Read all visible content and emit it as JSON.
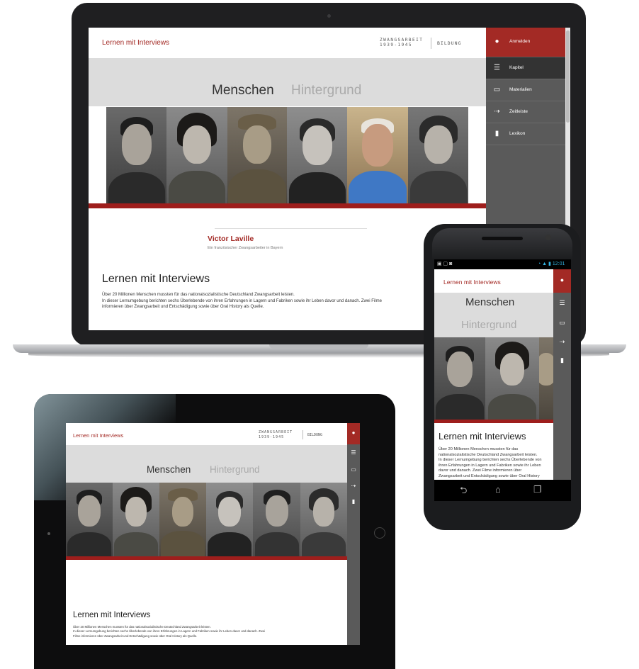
{
  "site": {
    "brand": "Lernen mit Interviews",
    "logo_line1": "ZWANGSARBEIT",
    "logo_line2": "1939-1945",
    "logo_section": "BILDUNG"
  },
  "tabs": [
    "Menschen",
    "Hintergrund"
  ],
  "sidebar": {
    "login": "Anmelden",
    "items": [
      {
        "label": "Kapitel",
        "icon": "menu-icon"
      },
      {
        "label": "Materialien",
        "icon": "folder-icon"
      },
      {
        "label": "Zeitleiste",
        "icon": "timeline-icon"
      },
      {
        "label": "Lexikon",
        "icon": "book-icon"
      }
    ]
  },
  "featured_person": {
    "name": "Victor Laville",
    "subtitle": "Ein französischer Zwangsarbeiter in Bayern"
  },
  "intro": {
    "heading": "Lernen mit Interviews",
    "line1": "Über 20 Millionen Menschen mussten für das nationalsozialistische Deutschland Zwangsarbeit leisten.",
    "line2": "In dieser Lernumgebung berichten sechs Überlebende von ihren Erfahrungen in Lagern und Fabriken sowie ihr Leben davor und danach. Zwei Filme informieren über Zwangsarbeit und Entschädigung sowie über Oral History als Quelle."
  },
  "phone_status": {
    "time": "12:01"
  },
  "colors": {
    "accent_red": "#a32a25",
    "sidebar_grey": "#5a5a5a",
    "tab_bar_grey": "#dcdcdc"
  }
}
